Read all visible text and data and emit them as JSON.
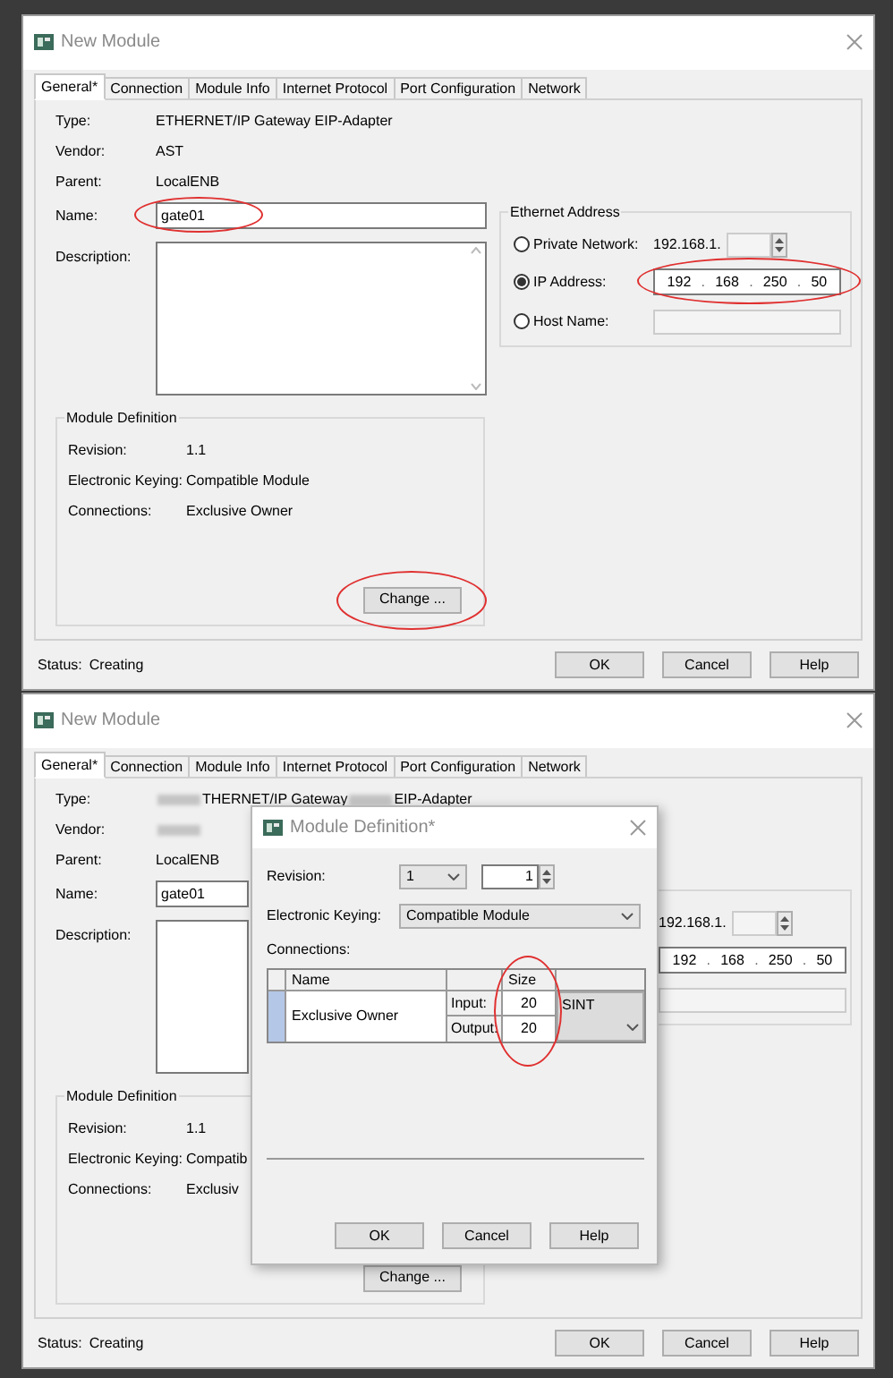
{
  "dialogs": [
    {
      "title": "New Module",
      "tabs": [
        {
          "label": "General*",
          "selected": true
        },
        {
          "label": "Connection",
          "selected": false
        },
        {
          "label": "Module Info",
          "selected": false
        },
        {
          "label": "Internet Protocol",
          "selected": false
        },
        {
          "label": "Port Configuration",
          "selected": false
        },
        {
          "label": "Network",
          "selected": false
        }
      ],
      "fields": [
        {
          "label": "Type:",
          "parts": [
            {
              "kind": "text",
              "text": "ETHERNET/IP Gateway EIP-Adapter"
            }
          ]
        },
        {
          "label": "Vendor:",
          "parts": [
            {
              "kind": "text",
              "text": "AST"
            }
          ]
        },
        {
          "label": "Parent:",
          "parts": [
            {
              "kind": "text",
              "text": "LocalENB"
            }
          ]
        }
      ],
      "name": {
        "label": "Name:",
        "value": "gate01",
        "highlighted": true
      },
      "description": {
        "label": "Description:"
      },
      "module_definition": {
        "title": "Module Definition",
        "rows": [
          {
            "label": "Revision:",
            "value": "1.1"
          },
          {
            "label": "Electronic Keying:",
            "value": "Compatible Module"
          },
          {
            "label": "Connections:",
            "value": "Exclusive Owner"
          }
        ],
        "change_button": {
          "label": "Change ...",
          "highlighted": true
        }
      },
      "ethernet_address": {
        "title": "Ethernet Address",
        "options": [
          {
            "kind": "private",
            "label": "Private Network:",
            "selected": false,
            "value": "192.168.1."
          },
          {
            "kind": "ip",
            "label": "IP Address:",
            "selected": true,
            "octets": [
              "192",
              "168",
              "250",
              "50"
            ],
            "separator": ".",
            "highlighted": true
          },
          {
            "kind": "host",
            "label": "Host Name:",
            "selected": false
          }
        ]
      },
      "status": {
        "label": "Status:",
        "value": "Creating"
      },
      "buttons": [
        "OK",
        "Cancel",
        "Help"
      ]
    },
    {
      "title": "New Module",
      "tabs": [
        {
          "label": "General*",
          "selected": true
        },
        {
          "label": "Connection",
          "selected": false
        },
        {
          "label": "Module Info",
          "selected": false
        },
        {
          "label": "Internet Protocol",
          "selected": false
        },
        {
          "label": "Port Configuration",
          "selected": false
        },
        {
          "label": "Network",
          "selected": false
        }
      ],
      "fields": [
        {
          "label": "Type:",
          "parts": [
            {
              "kind": "redacted"
            },
            {
              "kind": "text",
              "text": "THERNET/IP Gateway"
            },
            {
              "kind": "redacted"
            },
            {
              "kind": "text",
              "text": "EIP-Adapter"
            }
          ]
        },
        {
          "label": "Vendor:",
          "parts": [
            {
              "kind": "redacted"
            }
          ]
        },
        {
          "label": "Parent:",
          "parts": [
            {
              "kind": "text",
              "text": "LocalENB"
            }
          ]
        }
      ],
      "name": {
        "label": "Name:",
        "value": "gate01"
      },
      "description": {
        "label": "Description:"
      },
      "module_definition": {
        "title": "Module Definition",
        "rows": [
          {
            "label": "Revision:",
            "value": "1.1"
          },
          {
            "label": "Electronic Keying:",
            "value": "Compatib"
          },
          {
            "label": "Connections:",
            "value": "Exclusiv"
          }
        ],
        "change_button": {
          "label": "Change ..."
        }
      },
      "ethernet_address": {
        "options": [
          {
            "kind": "private",
            "value": "192.168.1."
          },
          {
            "kind": "ip",
            "octets": [
              "192",
              "168",
              "250",
              "50"
            ],
            "separator": "."
          },
          {
            "kind": "host"
          }
        ]
      },
      "status": {
        "label": "Status:",
        "value": "Creating"
      },
      "buttons": [
        "OK",
        "Cancel",
        "Help"
      ],
      "module_definition_dialog": {
        "title": "Module Definition*",
        "revision": {
          "label": "Revision:",
          "major": "1",
          "minor": "1"
        },
        "keying": {
          "label": "Electronic Keying:",
          "value": "Compatible Module"
        },
        "connections": {
          "label": "Connections:",
          "columns": [
            "Name",
            "Size"
          ],
          "size_highlighted": true,
          "rows": [
            {
              "name": "Exclusive Owner",
              "selected": true,
              "io": [
                {
                  "label": "Input:",
                  "size": "20"
                },
                {
                  "label": "Output:",
                  "size": "20"
                }
              ],
              "data_type": "SINT"
            }
          ]
        },
        "buttons": [
          "OK",
          "Cancel",
          "Help"
        ]
      }
    }
  ]
}
